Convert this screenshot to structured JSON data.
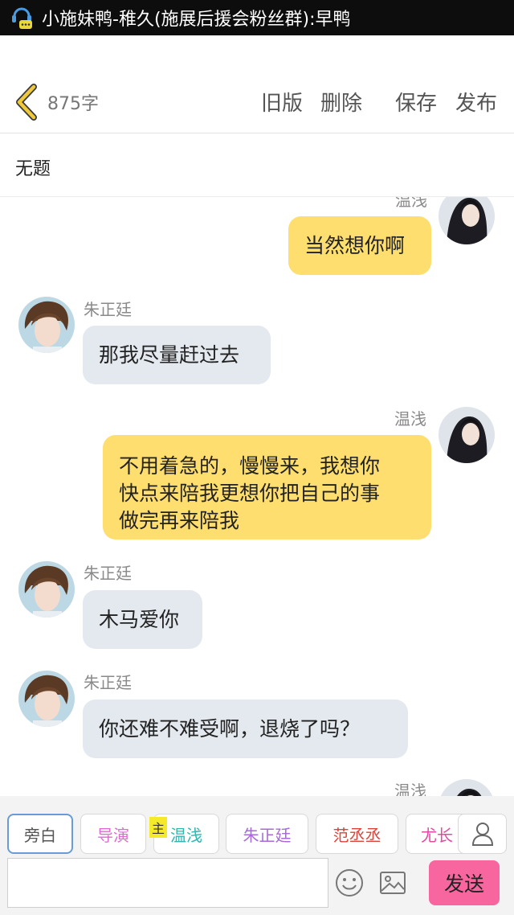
{
  "statusbar": {
    "notification": "小施妹鸭-稚久(施展后援会粉丝群):早鸭"
  },
  "header": {
    "word_count": "875字",
    "buttons": {
      "old": "旧版",
      "delete": "删除",
      "save": "保存",
      "publish": "发布"
    }
  },
  "doc_title": "无题",
  "messages": [
    {
      "speaker": "温浅",
      "side": "right",
      "text": "当然想你啊"
    },
    {
      "speaker": "朱正廷",
      "side": "left",
      "text": "那我尽量赶过去"
    },
    {
      "speaker": "温浅",
      "side": "right",
      "text": "不用着急的，慢慢来，我想你\n快点来陪我更想你把自己的事\n做完再来陪我"
    },
    {
      "speaker": "朱正廷",
      "side": "left",
      "text": "木马爱你"
    },
    {
      "speaker": "朱正廷",
      "side": "left",
      "text": "你还难不难受啊，退烧了吗？"
    },
    {
      "speaker": "温浅",
      "side": "right",
      "text": ""
    }
  ],
  "roles": [
    {
      "label": "旁白",
      "color": "#555555"
    },
    {
      "label": "导演",
      "color": "#e06ad0"
    },
    {
      "label": "温浅",
      "color": "#2fb6b0"
    },
    {
      "label": "朱正廷",
      "color": "#a86ad8"
    },
    {
      "label": "范丞丞",
      "color": "#d8443c"
    },
    {
      "label": "尤长",
      "color": "#e04aa0"
    }
  ],
  "main_role_tag": "主",
  "input": {
    "placeholder": ""
  },
  "send_label": "发送",
  "colors": {
    "bubble_right": "#fede6e",
    "bubble_left": "#e3e9ef",
    "send": "#f8669f",
    "back_arrow": "#e5b82e"
  },
  "icons": [
    "chat-app-icon",
    "back-chevron-icon",
    "person-icon",
    "emoji-icon",
    "image-icon"
  ]
}
